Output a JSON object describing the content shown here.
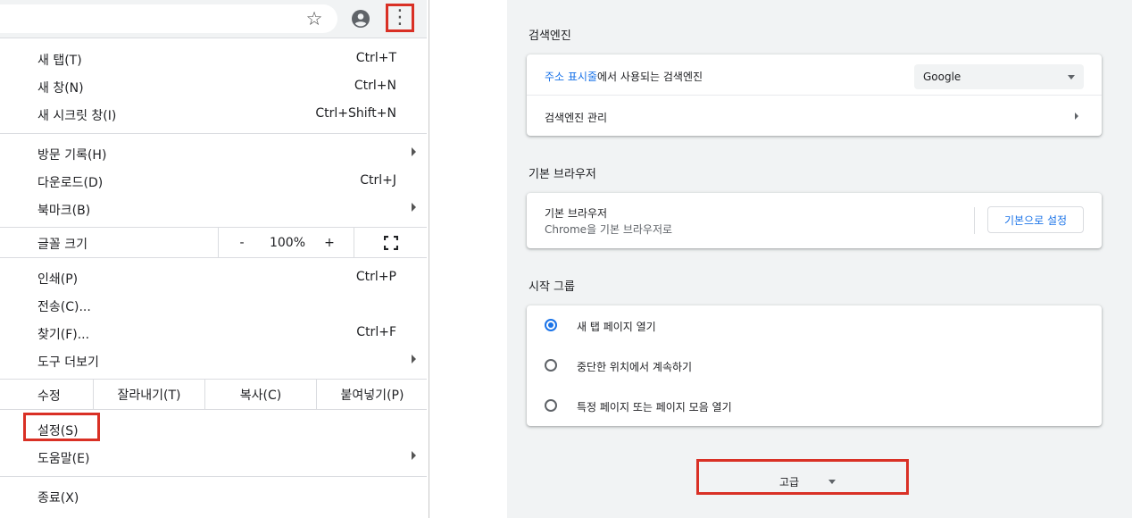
{
  "menu": {
    "items_group1": [
      {
        "label": "새 탭(T)",
        "shortcut": "Ctrl+T"
      },
      {
        "label": "새 창(N)",
        "shortcut": "Ctrl+N"
      },
      {
        "label": "새 시크릿 창(I)",
        "shortcut": "Ctrl+Shift+N"
      }
    ],
    "items_group2": [
      {
        "label": "방문 기록(H)",
        "shortcut": ""
      },
      {
        "label": "다운로드(D)",
        "shortcut": "Ctrl+J"
      },
      {
        "label": "북마크(B)",
        "shortcut": ""
      }
    ],
    "zoom": {
      "label": "글꼴 크기",
      "minus": "-",
      "value": "100%",
      "plus": "+"
    },
    "items_group3": [
      {
        "label": "인쇄(P)",
        "shortcut": "Ctrl+P"
      },
      {
        "label": "전송(C)...",
        "shortcut": ""
      },
      {
        "label": "찾기(F)...",
        "shortcut": "Ctrl+F"
      },
      {
        "label": "도구 더보기",
        "shortcut": ""
      }
    ],
    "edit": {
      "label": "수정",
      "cut": "잘라내기(T)",
      "copy": "복사(C)",
      "paste": "붙여넣기(P)"
    },
    "settings": "설정(S)",
    "help": "도움말(E)",
    "exit": "종료(X)"
  },
  "settings": {
    "search_engine": {
      "title": "검색엔진",
      "row1_link": "주소 표시줄",
      "row1_rest": "에서 사용되는 검색엔진",
      "dropdown_value": "Google",
      "row2": "검색엔진 관리"
    },
    "default_browser": {
      "title": "기본 브라우저",
      "row_title": "기본 브라우저",
      "row_sub": "Chrome을 기본 브라우저로",
      "button": "기본으로 설정"
    },
    "startup": {
      "title": "시작 그룹",
      "options": [
        "새 탭 페이지 열기",
        "중단한 위치에서 계속하기",
        "특정 페이지 또는 페이지 모음 열기"
      ],
      "selected_index": 0
    },
    "advanced": "고급"
  }
}
